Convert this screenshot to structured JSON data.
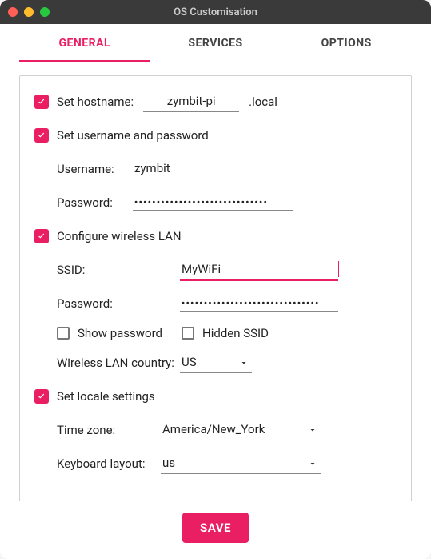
{
  "window_title": "OS Customisation",
  "tabs": {
    "general": "GENERAL",
    "services": "SERVICES",
    "options": "OPTIONS"
  },
  "hostname": {
    "checkbox_label": "Set hostname:",
    "value": "zymbit-pi",
    "suffix": ".local"
  },
  "userpass": {
    "checkbox_label": "Set username and password",
    "username_label": "Username:",
    "username_value": "zymbit",
    "password_label": "Password:",
    "password_mask": "••••••••••••••••••••••••••••••"
  },
  "wifi": {
    "checkbox_label": "Configure wireless LAN",
    "ssid_label": "SSID:",
    "ssid_value": "MyWiFi",
    "password_label": "Password:",
    "password_mask": "•••••••••••••••••••••••••••••••",
    "show_password_label": "Show password",
    "hidden_ssid_label": "Hidden SSID",
    "country_label": "Wireless LAN country:",
    "country_value": "US"
  },
  "locale": {
    "checkbox_label": "Set locale settings",
    "timezone_label": "Time zone:",
    "timezone_value": "America/New_York",
    "keyboard_label": "Keyboard layout:",
    "keyboard_value": "us"
  },
  "save_label": "SAVE",
  "colors": {
    "accent": "#e91e63"
  }
}
